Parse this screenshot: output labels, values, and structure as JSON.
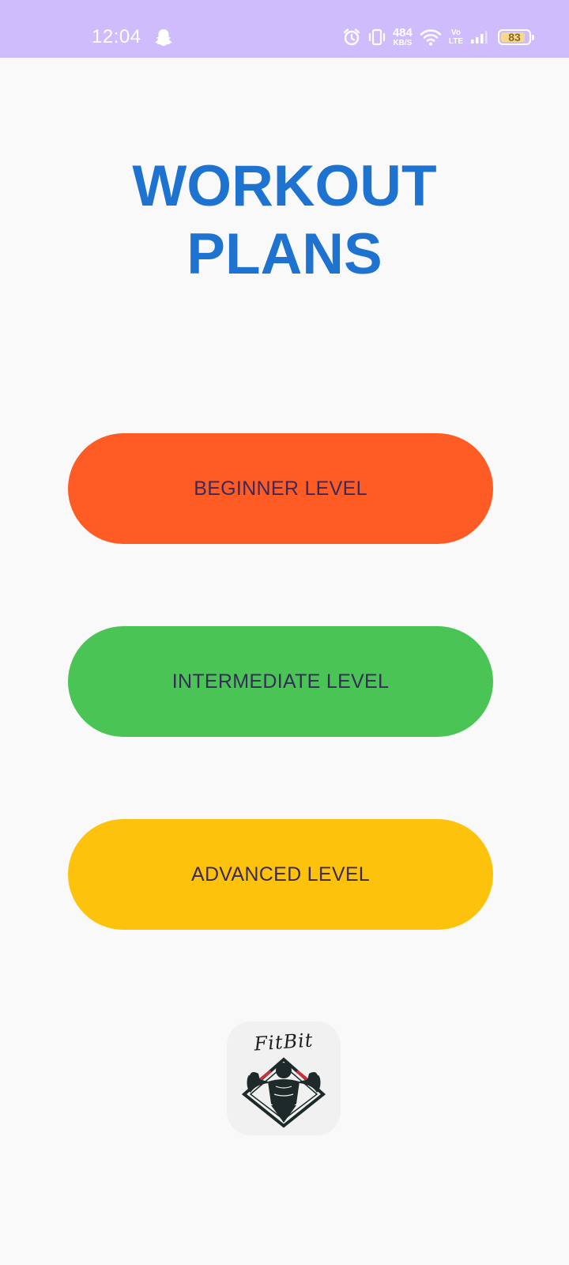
{
  "status_bar": {
    "time": "12:04",
    "net_speed_value": "484",
    "net_speed_unit": "KB/S",
    "volte_top": "Vo",
    "volte_bottom": "LTE",
    "battery": "83",
    "icons": [
      "snapchat-ghost-icon",
      "alarm-icon",
      "vibrate-icon",
      "wifi-icon",
      "signal-icon",
      "battery-icon"
    ],
    "background": "#cfbcfd"
  },
  "title": "WORKOUT\nPLANS",
  "buttons": {
    "beginner": {
      "label": "BEGINNER LEVEL",
      "color": "#ff5b25"
    },
    "intermediate": {
      "label": "INTERMEDIATE LEVEL",
      "color": "#4ac455"
    },
    "advanced": {
      "label": "ADVANCED LEVEL",
      "color": "#fdc20b"
    }
  },
  "logo": {
    "text": "FitBit",
    "icon": "bodybuilder-logo-icon"
  },
  "colors": {
    "title": "#1f73d0",
    "button_text": "#3a2a5c",
    "background": "#f9f9f9"
  }
}
